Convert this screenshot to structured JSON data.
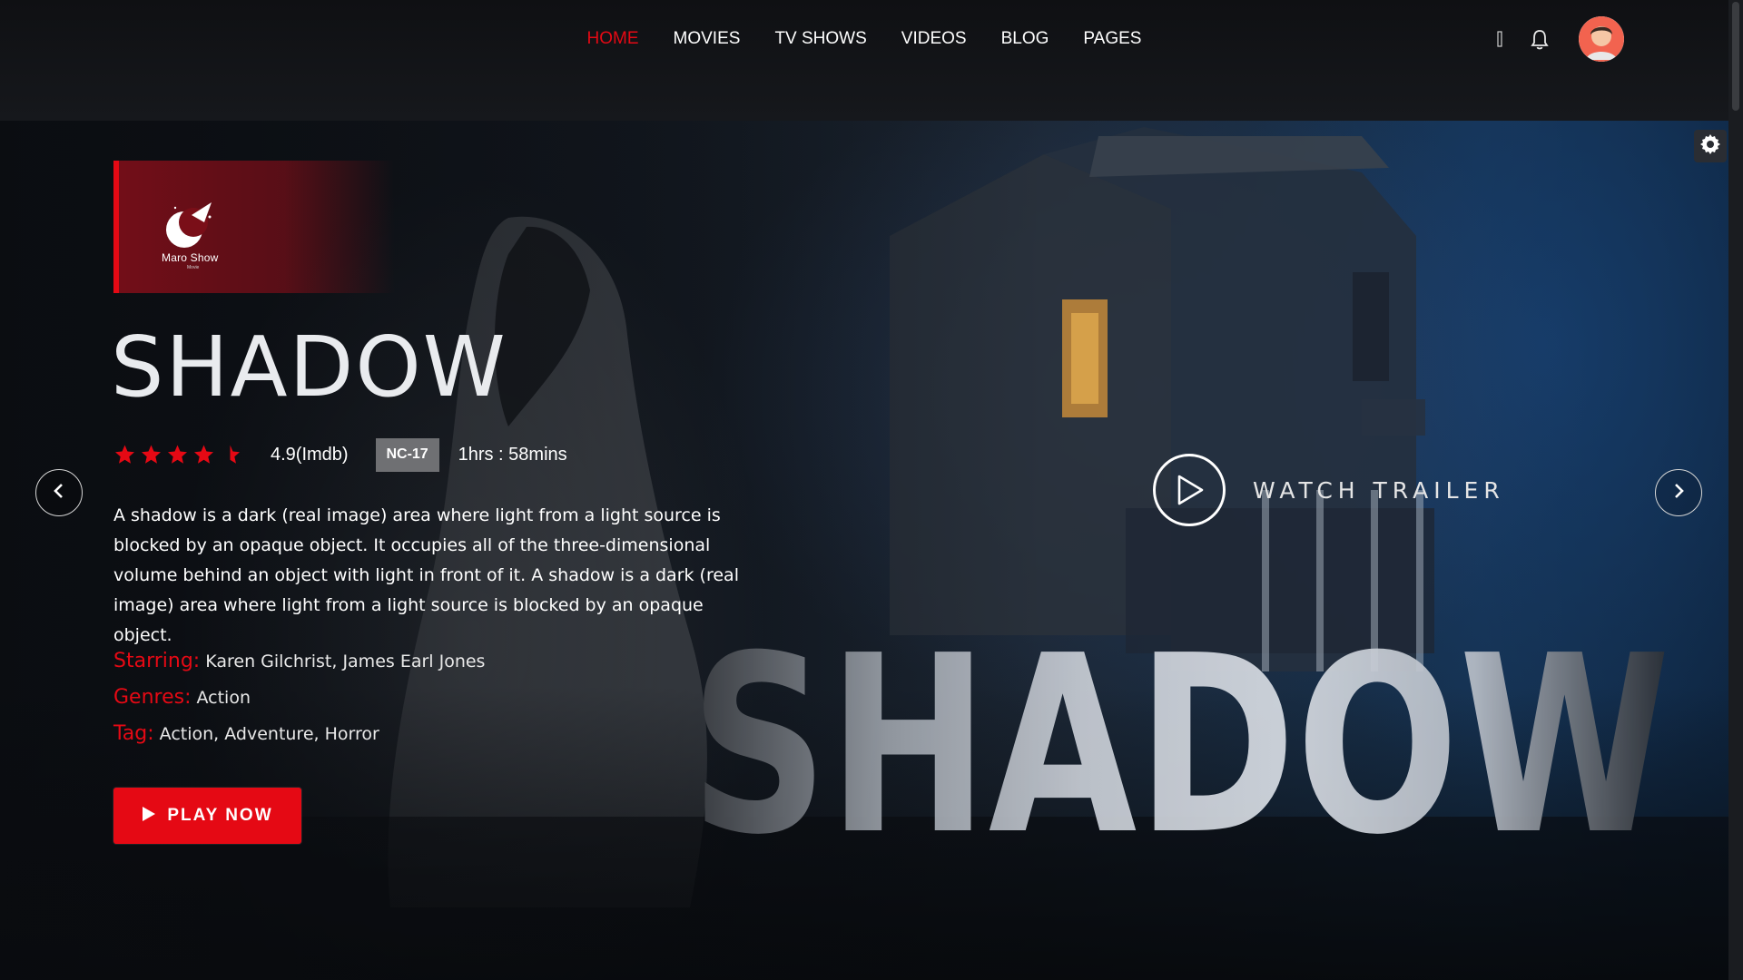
{
  "nav": {
    "items": [
      {
        "label": "HOME",
        "active": true
      },
      {
        "label": "MOVIES",
        "active": false
      },
      {
        "label": "TV SHOWS",
        "active": false
      },
      {
        "label": "VIDEOS",
        "active": false
      },
      {
        "label": "BLOG",
        "active": false
      },
      {
        "label": "PAGES",
        "active": false
      }
    ],
    "active_color": "#e50914"
  },
  "header": {
    "icons": [
      "search-icon",
      "bell-icon",
      "avatar"
    ]
  },
  "hero": {
    "logo": {
      "text": "Maro Show",
      "subtext": "Movie"
    },
    "title": "SHADOW",
    "rating_stars": 4.5,
    "rating_text": "4.9(Imdb)",
    "age_rating": "NC-17",
    "duration": "1hrs : 58mins",
    "description": "A shadow is a dark (real image) area where light from a light source is blocked by an opaque object. It occupies all of the three-dimensional volume behind an object with light in front of it. A shadow is a dark (real image) area where light from a light source is blocked by an opaque object.",
    "starring_label": "Starring:",
    "starring_value": "Karen Gilchrist, James Earl Jones",
    "genres_label": "Genres:",
    "genres_value": "Action",
    "tag_label": "Tag:",
    "tag_value": "Action, Adventure, Horror",
    "play_button": "PLAY NOW",
    "watch_trailer": "WATCH TRAILER",
    "big_title": "SHADOW"
  },
  "colors": {
    "accent": "#e50914",
    "badge": "#6f7073"
  }
}
